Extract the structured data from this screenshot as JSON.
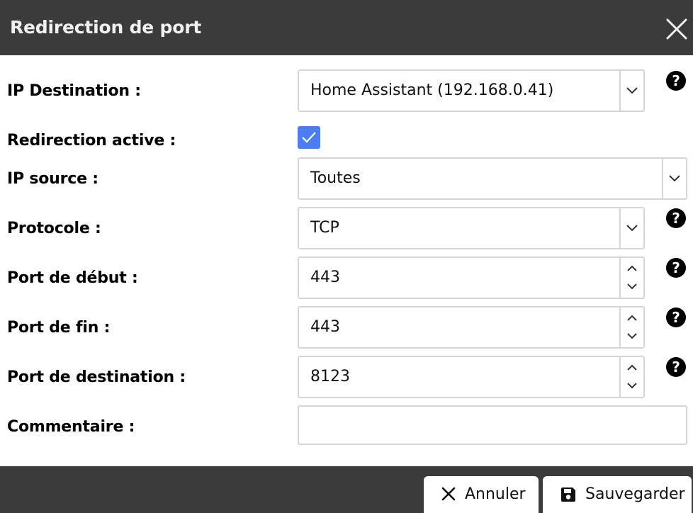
{
  "dialog": {
    "title": "Redirection de port"
  },
  "fields": {
    "ip_destination": {
      "label": "IP Destination :",
      "value": "Home Assistant (192.168.0.41)"
    },
    "redirection_active": {
      "label": "Redirection active :",
      "checked": true
    },
    "ip_source": {
      "label": "IP source :",
      "value": "Toutes"
    },
    "protocole": {
      "label": "Protocole :",
      "value": "TCP"
    },
    "port_debut": {
      "label": "Port de début :",
      "value": "443"
    },
    "port_fin": {
      "label": "Port de fin :",
      "value": "443"
    },
    "port_destination": {
      "label": "Port de destination :",
      "value": "8123"
    },
    "commentaire": {
      "label": "Commentaire :",
      "value": ""
    }
  },
  "help_glyph": "?",
  "footer": {
    "cancel_label": "Annuler",
    "save_label": "Sauvegarder"
  },
  "colors": {
    "header_bg": "#3b3b3b",
    "checkbox_accent": "#4a7cf3"
  }
}
